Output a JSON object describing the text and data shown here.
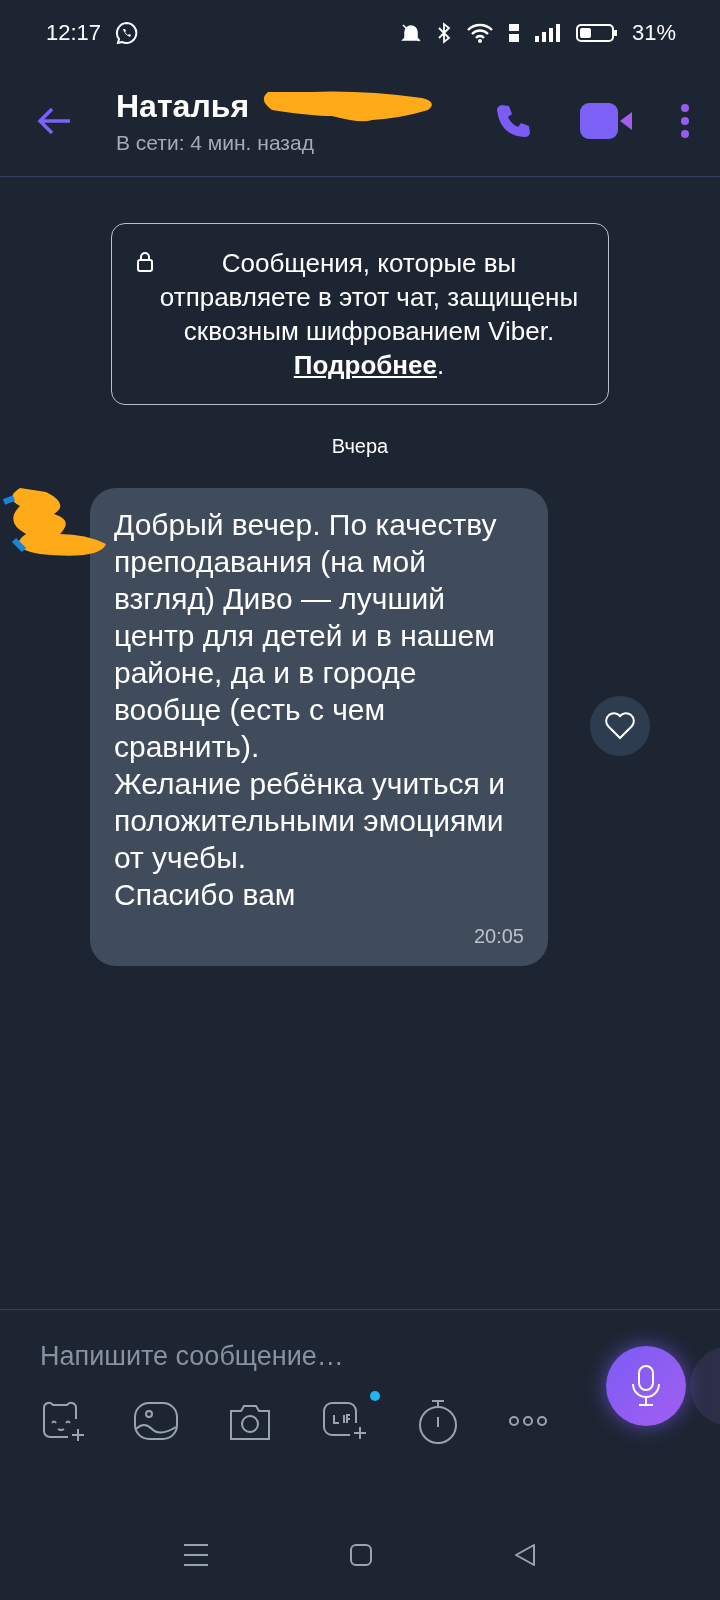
{
  "status_bar": {
    "time": "12:17",
    "battery": "31%"
  },
  "header": {
    "name": "Наталья",
    "status": "В сети: 4 мин. назад"
  },
  "notice": {
    "text": "Сообщения, которые вы отправляете в этот чат, защищены сквозным шифрованием Viber.",
    "link": "Подробнее",
    "suffix": "."
  },
  "date_separator": "Вчера",
  "messages": [
    {
      "text": "Добрый вечер. По качеству преподавания (на мой взгляд) Диво — лучший центр для детей и в нашем районе, да и в городе вообще (есть с чем сравнить).\nЖелание ребёнка учиться и положительными эмоциями от учебы.\nСпасибо вам",
      "time": "20:05",
      "liked": false
    }
  ],
  "composer": {
    "placeholder": "Напишите сообщение…"
  },
  "toolbar": [
    {
      "kind": "sticker",
      "badge": false
    },
    {
      "kind": "gallery",
      "badge": false
    },
    {
      "kind": "camera",
      "badge": false
    },
    {
      "kind": "gif",
      "badge": true
    },
    {
      "kind": "timer",
      "badge": false
    },
    {
      "kind": "more",
      "badge": false
    }
  ]
}
